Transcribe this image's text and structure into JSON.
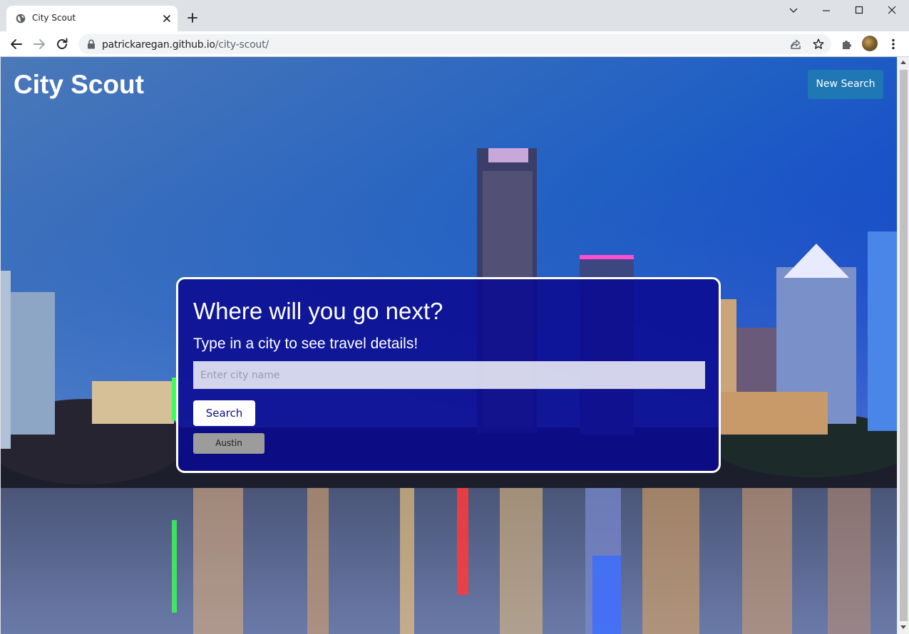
{
  "browser": {
    "tab_title": "City Scout",
    "url_host": "patrickaregan.github.io",
    "url_path": "/city-scout/"
  },
  "page": {
    "site_title": "City Scout",
    "new_search_label": "New Search",
    "heading": "Where will you go next?",
    "subheading": "Type in a city to see travel details!",
    "search_placeholder": "Enter city name",
    "search_value": "",
    "search_button_label": "Search",
    "history": [
      {
        "label": "Austin"
      }
    ]
  },
  "colors": {
    "card_background": "#0a0a91",
    "new_search_button": "#1f77b4",
    "history_button": "#9c9c9c"
  },
  "icons": {
    "tab_favicon": "globe-icon",
    "tab_close": "close-icon",
    "new_tab": "plus-icon",
    "back": "arrow-left-icon",
    "forward": "arrow-right-icon",
    "reload": "reload-icon",
    "lock": "lock-icon",
    "share": "share-icon",
    "bookmark": "star-icon",
    "extensions": "puzzle-icon",
    "menu": "kebab-menu-icon"
  }
}
